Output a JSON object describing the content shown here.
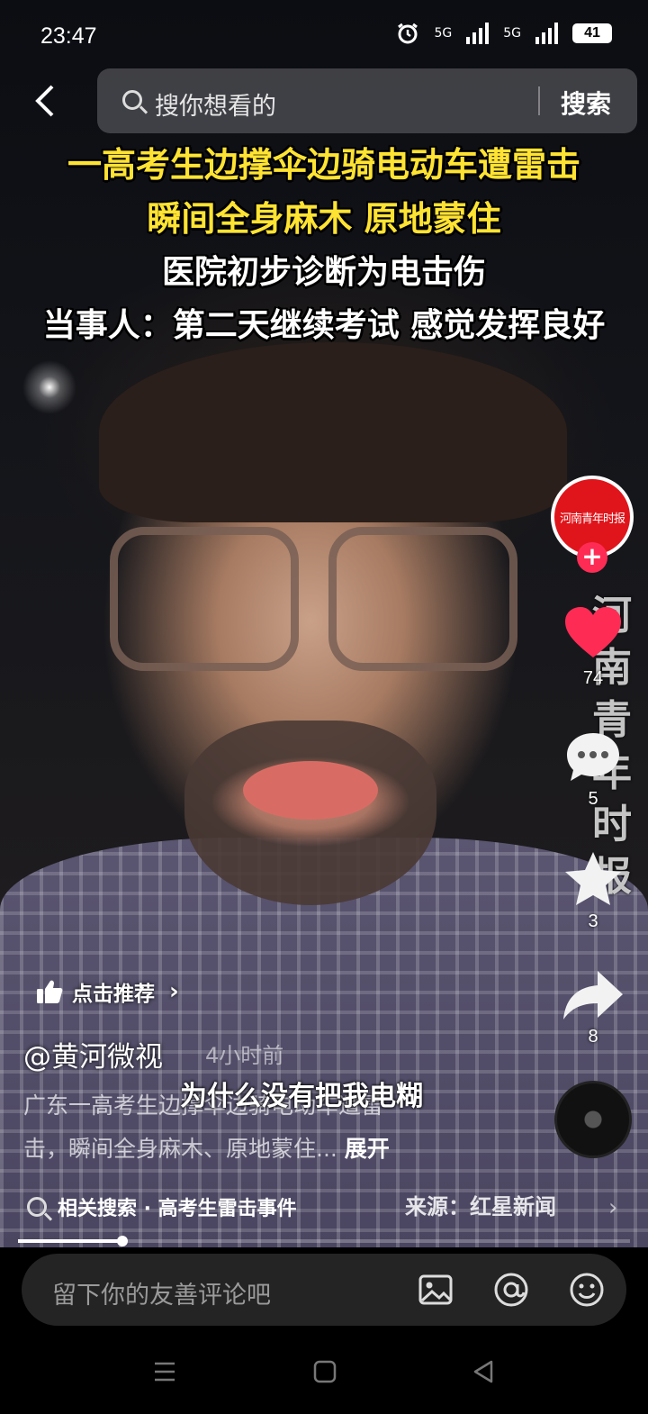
{
  "status_bar": {
    "time": "23:47",
    "network1": "5G",
    "network2": "5G",
    "battery": "41"
  },
  "search": {
    "placeholder": "搜你想看的",
    "button": "搜索"
  },
  "headline": {
    "line1": "一高考生边撑伞边骑电动车遭雷击",
    "line2": "瞬间全身麻木 原地蒙住",
    "line3": "医院初步诊断为电击伤",
    "line4": "当事人：第二天继续考试 感觉发挥良好"
  },
  "sidebar": {
    "avatar_text": "河南青年时报",
    "follow": "+",
    "watermark": "河南青年时报",
    "likes": "74",
    "comments": "5",
    "favorites": "3",
    "shares": "8"
  },
  "post": {
    "recommend_label": "点击推荐",
    "author": "@黄河微视",
    "time": "4小时前",
    "desc_line1": "广东一高考生边撑伞边骑电动车遭雷",
    "desc_line2": "击，瞬间全身麻木、原地蒙住...",
    "expand": "展开",
    "subtitle": "为什么没有把我电糊"
  },
  "related": {
    "label": "相关搜索 · 高考生雷击事件",
    "source": "来源：红星新闻"
  },
  "progress": {
    "value": 0.17
  },
  "comment_bar": {
    "placeholder": "留下你的友善评论吧"
  },
  "colors": {
    "headline_yellow": "#ffe333",
    "like_red": "#fe2c55",
    "avatar_red": "#e0151b"
  }
}
